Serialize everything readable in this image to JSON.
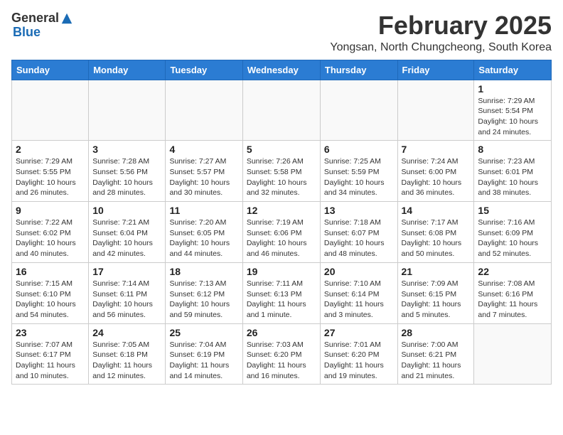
{
  "header": {
    "logo_general": "General",
    "logo_blue": "Blue",
    "month_title": "February 2025",
    "location": "Yongsan, North Chungcheong, South Korea"
  },
  "weekdays": [
    "Sunday",
    "Monday",
    "Tuesday",
    "Wednesday",
    "Thursday",
    "Friday",
    "Saturday"
  ],
  "weeks": [
    [
      null,
      null,
      null,
      null,
      null,
      null,
      {
        "day": "1",
        "sunrise": "7:29 AM",
        "sunset": "5:54 PM",
        "daylight": "10 hours and 24 minutes."
      }
    ],
    [
      {
        "day": "2",
        "sunrise": "7:29 AM",
        "sunset": "5:55 PM",
        "daylight": "10 hours and 26 minutes."
      },
      {
        "day": "3",
        "sunrise": "7:28 AM",
        "sunset": "5:56 PM",
        "daylight": "10 hours and 28 minutes."
      },
      {
        "day": "4",
        "sunrise": "7:27 AM",
        "sunset": "5:57 PM",
        "daylight": "10 hours and 30 minutes."
      },
      {
        "day": "5",
        "sunrise": "7:26 AM",
        "sunset": "5:58 PM",
        "daylight": "10 hours and 32 minutes."
      },
      {
        "day": "6",
        "sunrise": "7:25 AM",
        "sunset": "5:59 PM",
        "daylight": "10 hours and 34 minutes."
      },
      {
        "day": "7",
        "sunrise": "7:24 AM",
        "sunset": "6:00 PM",
        "daylight": "10 hours and 36 minutes."
      },
      {
        "day": "8",
        "sunrise": "7:23 AM",
        "sunset": "6:01 PM",
        "daylight": "10 hours and 38 minutes."
      }
    ],
    [
      {
        "day": "9",
        "sunrise": "7:22 AM",
        "sunset": "6:02 PM",
        "daylight": "10 hours and 40 minutes."
      },
      {
        "day": "10",
        "sunrise": "7:21 AM",
        "sunset": "6:04 PM",
        "daylight": "10 hours and 42 minutes."
      },
      {
        "day": "11",
        "sunrise": "7:20 AM",
        "sunset": "6:05 PM",
        "daylight": "10 hours and 44 minutes."
      },
      {
        "day": "12",
        "sunrise": "7:19 AM",
        "sunset": "6:06 PM",
        "daylight": "10 hours and 46 minutes."
      },
      {
        "day": "13",
        "sunrise": "7:18 AM",
        "sunset": "6:07 PM",
        "daylight": "10 hours and 48 minutes."
      },
      {
        "day": "14",
        "sunrise": "7:17 AM",
        "sunset": "6:08 PM",
        "daylight": "10 hours and 50 minutes."
      },
      {
        "day": "15",
        "sunrise": "7:16 AM",
        "sunset": "6:09 PM",
        "daylight": "10 hours and 52 minutes."
      }
    ],
    [
      {
        "day": "16",
        "sunrise": "7:15 AM",
        "sunset": "6:10 PM",
        "daylight": "10 hours and 54 minutes."
      },
      {
        "day": "17",
        "sunrise": "7:14 AM",
        "sunset": "6:11 PM",
        "daylight": "10 hours and 56 minutes."
      },
      {
        "day": "18",
        "sunrise": "7:13 AM",
        "sunset": "6:12 PM",
        "daylight": "10 hours and 59 minutes."
      },
      {
        "day": "19",
        "sunrise": "7:11 AM",
        "sunset": "6:13 PM",
        "daylight": "11 hours and 1 minute."
      },
      {
        "day": "20",
        "sunrise": "7:10 AM",
        "sunset": "6:14 PM",
        "daylight": "11 hours and 3 minutes."
      },
      {
        "day": "21",
        "sunrise": "7:09 AM",
        "sunset": "6:15 PM",
        "daylight": "11 hours and 5 minutes."
      },
      {
        "day": "22",
        "sunrise": "7:08 AM",
        "sunset": "6:16 PM",
        "daylight": "11 hours and 7 minutes."
      }
    ],
    [
      {
        "day": "23",
        "sunrise": "7:07 AM",
        "sunset": "6:17 PM",
        "daylight": "11 hours and 10 minutes."
      },
      {
        "day": "24",
        "sunrise": "7:05 AM",
        "sunset": "6:18 PM",
        "daylight": "11 hours and 12 minutes."
      },
      {
        "day": "25",
        "sunrise": "7:04 AM",
        "sunset": "6:19 PM",
        "daylight": "11 hours and 14 minutes."
      },
      {
        "day": "26",
        "sunrise": "7:03 AM",
        "sunset": "6:20 PM",
        "daylight": "11 hours and 16 minutes."
      },
      {
        "day": "27",
        "sunrise": "7:01 AM",
        "sunset": "6:20 PM",
        "daylight": "11 hours and 19 minutes."
      },
      {
        "day": "28",
        "sunrise": "7:00 AM",
        "sunset": "6:21 PM",
        "daylight": "11 hours and 21 minutes."
      },
      null
    ]
  ]
}
